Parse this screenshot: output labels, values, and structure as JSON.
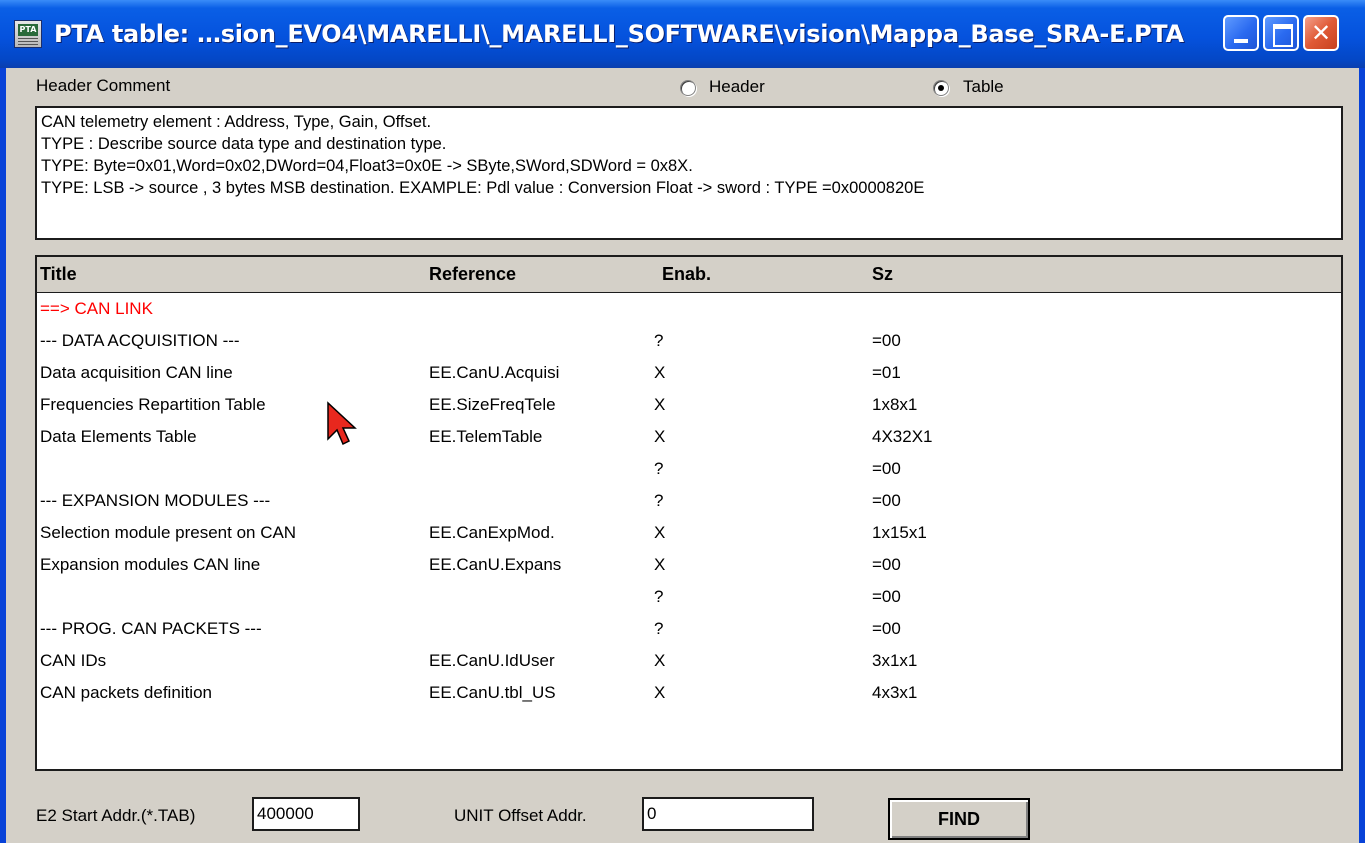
{
  "window": {
    "title": "PTA table:  …sion_EVO4\\MARELLI\\_MARELLI_SOFTWARE\\vision\\Mappa_Base_SRA-E.PTA",
    "icon": "pta-app-icon",
    "icon_text": "PTA"
  },
  "header_comment_label": "Header Comment",
  "view_mode": {
    "options": [
      "Header",
      "Table"
    ],
    "selected": "Table"
  },
  "comment_lines": [
    "CAN telemetry element : Address, Type, Gain, Offset.",
    "TYPE : Describe source data type and destination type.",
    "TYPE: Byte=0x01,Word=0x02,DWord=04,Float3=0x0E -> SByte,SWord,SDWord = 0x8X.",
    "TYPE: LSB -> source , 3 bytes MSB destination.  EXAMPLE: Pdl value : Conversion Float -> sword : TYPE =0x0000820E"
  ],
  "table": {
    "columns": [
      "Title",
      "Reference",
      "Enab.",
      "Sz"
    ],
    "rows": [
      {
        "title": "==> CAN LINK",
        "reference": "",
        "enab": "",
        "sz": "",
        "highlight": true
      },
      {
        "title": "--- DATA ACQUISITION ---",
        "reference": "",
        "enab": "?",
        "sz": "=00"
      },
      {
        "title": "Data acquisition CAN line",
        "reference": "EE.CanU.Acquisi",
        "enab": "X",
        "sz": "=01"
      },
      {
        "title": "Frequencies Repartition Table",
        "reference": "EE.SizeFreqTele",
        "enab": "X",
        "sz": "1x8x1"
      },
      {
        "title": "Data Elements Table",
        "reference": "EE.TelemTable",
        "enab": "X",
        "sz": "4X32X1"
      },
      {
        "title": "",
        "reference": "",
        "enab": "?",
        "sz": "=00"
      },
      {
        "title": "--- EXPANSION MODULES ---",
        "reference": "",
        "enab": "?",
        "sz": "=00"
      },
      {
        "title": "Selection module present on CAN",
        "reference": "EE.CanExpMod.",
        "enab": "X",
        "sz": "1x15x1"
      },
      {
        "title": "Expansion modules CAN line",
        "reference": "EE.CanU.Expans",
        "enab": "X",
        "sz": "=00"
      },
      {
        "title": "",
        "reference": "",
        "enab": "?",
        "sz": "=00"
      },
      {
        "title": "--- PROG. CAN PACKETS ---",
        "reference": "",
        "enab": "?",
        "sz": "=00"
      },
      {
        "title": "CAN IDs",
        "reference": "EE.CanU.IdUser",
        "enab": "X",
        "sz": "3x1x1"
      },
      {
        "title": "CAN packets definition",
        "reference": "EE.CanU.tbl_US",
        "enab": "X",
        "sz": "4x3x1"
      }
    ]
  },
  "footer": {
    "e2_start_label": "E2 Start Addr.(*.TAB)",
    "e2_start_value": "400000",
    "unit_offset_label": "UNIT Offset Addr.",
    "unit_offset_value": "0",
    "find_label": "FIND"
  },
  "colors": {
    "titlebar": "#0552dd",
    "client": "#d4d0c8",
    "highlight_row": "#ff0000",
    "close_button": "#e05a36"
  },
  "icons": [
    "pta-app-icon",
    "minimize-icon",
    "maximize-icon",
    "close-icon",
    "mouse-cursor-icon"
  ]
}
